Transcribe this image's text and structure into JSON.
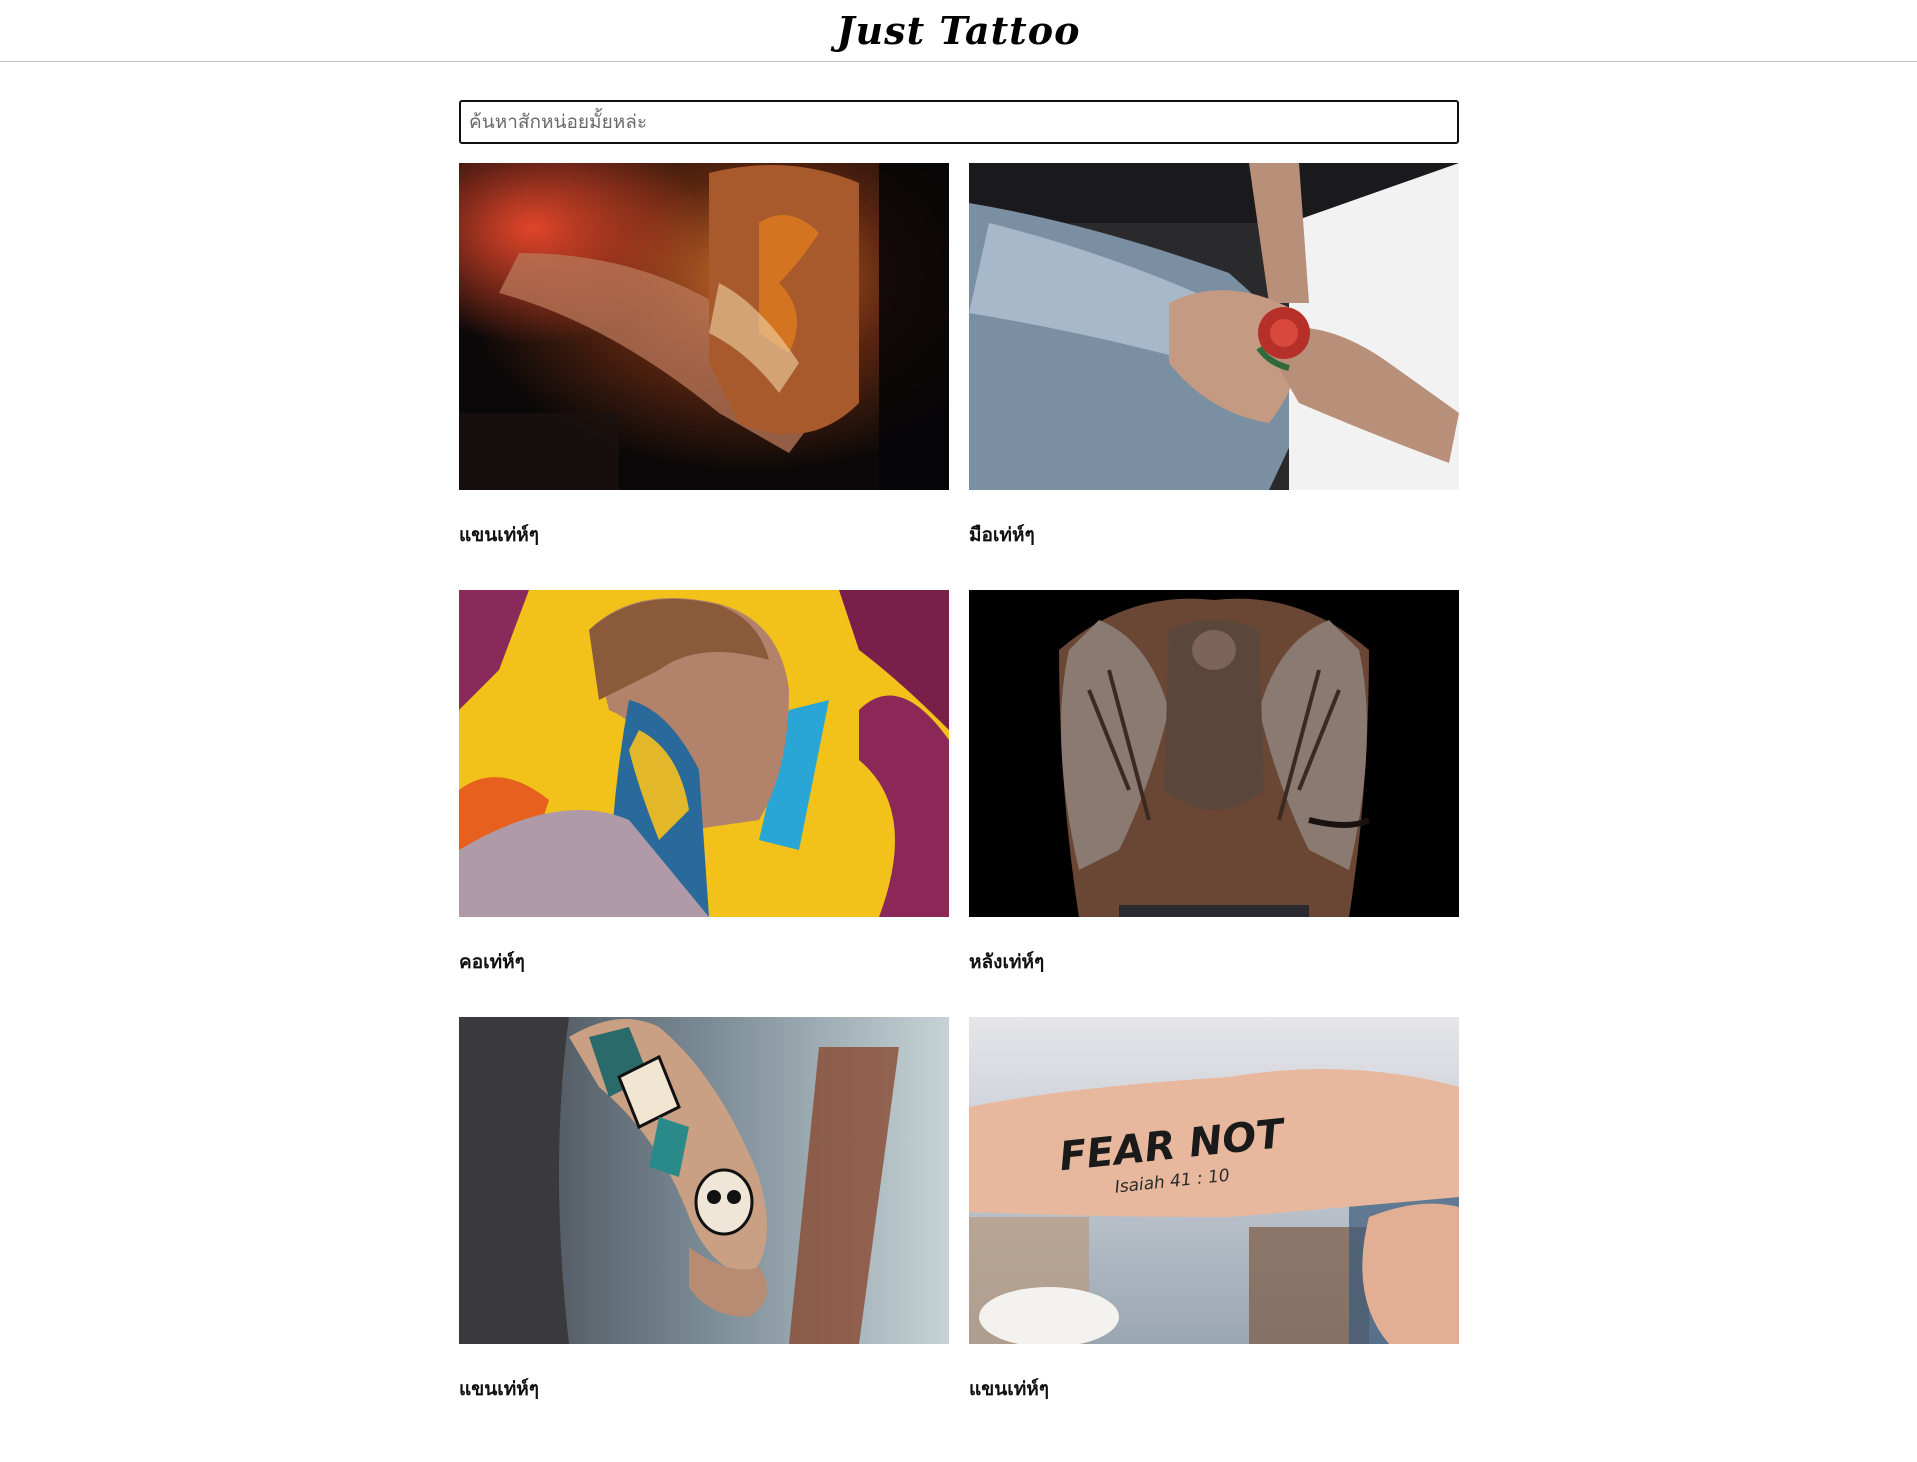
{
  "header": {
    "logo": "Just Tattoo"
  },
  "search": {
    "placeholder": "ค้นหาสักหน่อยมั้ยหล่ะ"
  },
  "cards": [
    {
      "caption": "แขนเท่ห์ๆ",
      "image": "arm-sleeve-tattoo-photo"
    },
    {
      "caption": "มือเท่ห์ๆ",
      "image": "hand-rose-tattoo-photo"
    },
    {
      "caption": "คอเท่ห์ๆ",
      "image": "neck-tattoo-man-graffiti-photo"
    },
    {
      "caption": "หลังเท่ห์ๆ",
      "image": "back-angel-wings-tattoo-photo"
    },
    {
      "caption": "แขนเท่ห์ๆ",
      "image": "forearm-skull-tattoo-photo"
    },
    {
      "caption": "แขนเท่ห์ๆ",
      "image": "forearm-fear-not-tattoo-photo",
      "tattoo_text": "FEAR NOT",
      "tattoo_subtext": "Isaiah 41 : 10"
    }
  ]
}
